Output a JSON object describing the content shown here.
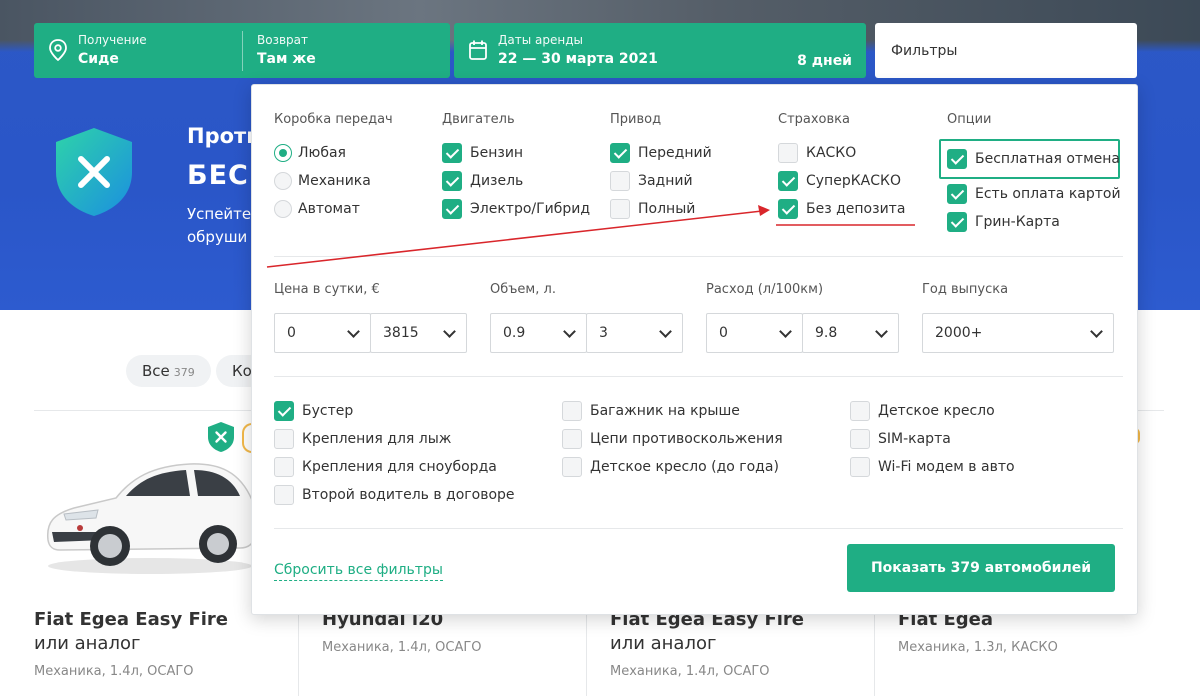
{
  "hero": {
    "line1": "Проти",
    "line2": "БЕС",
    "line3a": "Успейте",
    "line3b": "обруши"
  },
  "search": {
    "pickup_label": "Получение",
    "pickup_value": "Сиде",
    "return_label": "Возврат",
    "return_value": "Там же",
    "dates_label": "Даты аренды",
    "dates_value": "22 — 30 марта 2021",
    "days": "8 дней",
    "filters_label": "Фильтры"
  },
  "chips": [
    {
      "label": "Все",
      "count": "379"
    },
    {
      "label": "Ко",
      "count": ""
    }
  ],
  "cards": [
    {
      "title": "Fiat Egea Easy Fire",
      "subtitle": "или аналог",
      "meta": "Механика, 1.4л, ОСАГО"
    },
    {
      "title": "Hyundai i20",
      "subtitle": "",
      "meta": "Механика, 1.4л, ОСАГО"
    },
    {
      "title": "Fiat Egea Easy Fire",
      "subtitle": "или аналог",
      "meta": "Механика, 1.4л, ОСАГО"
    },
    {
      "title": "Fiat Egea",
      "subtitle": "",
      "meta": "Механика, 1.3л, КАСКО"
    }
  ],
  "filters": {
    "transmission": {
      "title": "Коробка передач",
      "options": [
        {
          "label": "Любая",
          "selected": true
        },
        {
          "label": "Механика",
          "selected": false
        },
        {
          "label": "Автомат",
          "selected": false
        }
      ]
    },
    "engine": {
      "title": "Двигатель",
      "options": [
        {
          "label": "Бензин",
          "checked": true
        },
        {
          "label": "Дизель",
          "checked": true
        },
        {
          "label": "Электро/Гибрид",
          "checked": true
        }
      ]
    },
    "drive": {
      "title": "Привод",
      "options": [
        {
          "label": "Передний",
          "checked": true
        },
        {
          "label": "Задний",
          "checked": false
        },
        {
          "label": "Полный",
          "checked": false
        }
      ]
    },
    "insurance": {
      "title": "Страховка",
      "options": [
        {
          "label": "КАСКО",
          "checked": false
        },
        {
          "label": "СуперКАСКО",
          "checked": true
        },
        {
          "label": "Без депозита",
          "checked": true
        }
      ]
    },
    "options": {
      "title": "Опции",
      "options": [
        {
          "label": "Бесплатная отмена",
          "checked": true
        },
        {
          "label": "Есть оплата картой",
          "checked": true
        },
        {
          "label": "Грин-Карта",
          "checked": true
        }
      ]
    },
    "ranges": {
      "price": {
        "title": "Цена в сутки, €",
        "from": "0",
        "to": "3815"
      },
      "volume": {
        "title": "Объем, л.",
        "from": "0.9",
        "to": "3"
      },
      "consumption": {
        "title": "Расход (л/100км)",
        "from": "0",
        "to": "9.8"
      },
      "year": {
        "title": "Год выпуска",
        "value": "2000+"
      }
    },
    "extras": [
      {
        "label": "Бустер",
        "checked": true
      },
      {
        "label": "Крепления для лыж",
        "checked": false
      },
      {
        "label": "Крепления для сноуборда",
        "checked": false
      },
      {
        "label": "Второй водитель в договоре",
        "checked": false
      },
      {
        "label": "Багажник на крыше",
        "checked": false
      },
      {
        "label": "Цепи противоскольжения",
        "checked": false
      },
      {
        "label": "Детское кресло (до года)",
        "checked": false
      },
      {
        "label": "Детское кресло",
        "checked": false
      },
      {
        "label": "SIM-карта",
        "checked": false
      },
      {
        "label": "Wi-Fi модем в авто",
        "checked": false
      }
    ],
    "reset_label": "Сбросить все фильтры",
    "show_label": "Показать 379 автомобилей"
  },
  "colors": {
    "accent": "#1fae84",
    "hero": "#2c58c6",
    "annotation": "#d9262b"
  }
}
